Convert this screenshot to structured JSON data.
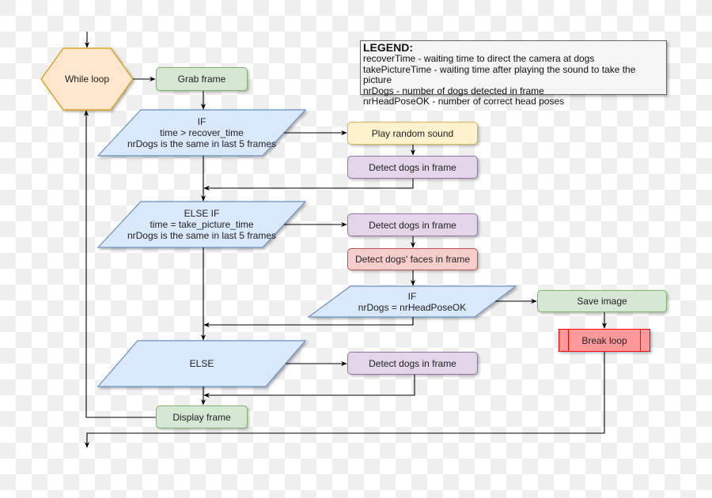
{
  "legend": {
    "title": "LEGEND:",
    "items": [
      "recoverTime - waiting time to direct the camera at dogs",
      "takePictureTime - waiting time after playing the sound to take the picture",
      "nrDogs - number of dogs detected in frame",
      "nrHeadPoseOK - number of correct head poses"
    ]
  },
  "nodes": {
    "while_loop": "While loop",
    "grab_frame": "Grab frame",
    "if_recover": [
      "IF",
      "time > recover_time",
      "nrDogs is the same in last 5 frames"
    ],
    "play_sound": "Play random sound",
    "detect_dogs_1": "Detect dogs in frame",
    "else_if_picture": [
      "ELSE IF",
      "time = take_picture_time",
      "nrDogs is the same in last 5 frames"
    ],
    "detect_dogs_2": "Detect dogs in frame",
    "detect_faces": "Detect dogs' faces in frame",
    "if_headpose": [
      "IF",
      "nrDogs = nrHeadPoseOK"
    ],
    "save_image": "Save image",
    "break_loop": "Break loop",
    "else": "ELSE",
    "detect_dogs_3": "Detect dogs in frame",
    "display_frame": "Display frame"
  },
  "colors": {
    "process_green": "#d5e8d4",
    "sound_yellow": "#fff2cc",
    "detect_purple": "#e1d5e7",
    "faces_red": "#f8cecc",
    "break_red": "#ff9999",
    "decision_blue": "#dae8fc",
    "loop_orange": "#ffe6cc"
  }
}
